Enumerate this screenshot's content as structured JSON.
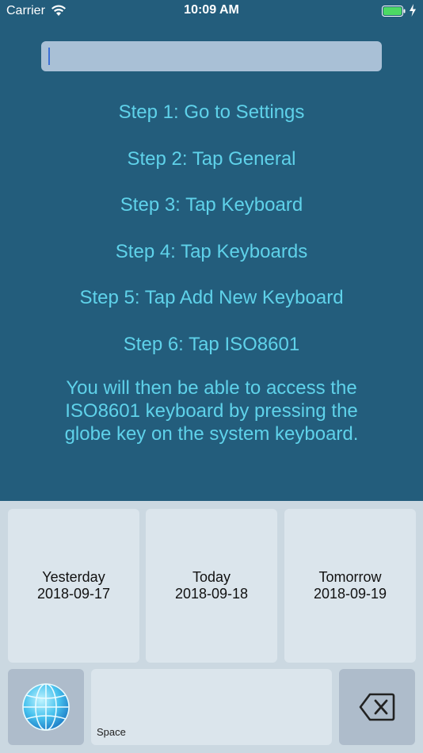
{
  "status": {
    "carrier": "Carrier",
    "time": "10:09 AM"
  },
  "input": {
    "value": ""
  },
  "instructions": {
    "steps": [
      "Step 1: Go to Settings",
      "Step 2: Tap General",
      "Step 3: Tap Keyboard",
      "Step 4: Tap Keyboards",
      "Step 5: Tap Add New Keyboard",
      "Step 6: Tap ISO8601"
    ],
    "note": "You will then be able to access the ISO8601 keyboard by pressing the globe key on the system keyboard."
  },
  "keyboard": {
    "dates": [
      {
        "label": "Yesterday",
        "date": "2018-09-17"
      },
      {
        "label": "Today",
        "date": "2018-09-18"
      },
      {
        "label": "Tomorrow",
        "date": "2018-09-19"
      }
    ],
    "space_label": "Space",
    "globe_icon": "globe-icon",
    "delete_icon": "backspace-icon"
  },
  "colors": {
    "background": "#235d7c",
    "text_accent": "#5fd2ea",
    "keyboard_bg": "#cbd8e1",
    "key_light": "#dbe5ec",
    "key_dark": "#aebccb"
  }
}
